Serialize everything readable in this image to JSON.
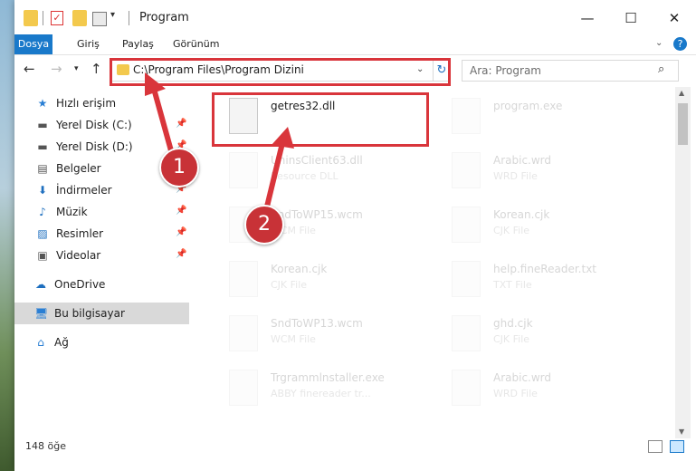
{
  "window": {
    "title": "Program"
  },
  "ribbon": {
    "tabs": [
      "Dosya",
      "Giriş",
      "Paylaş",
      "Görünüm"
    ]
  },
  "address": {
    "path": "C:\\Program Files\\Program Dizini"
  },
  "search": {
    "placeholder": "Ara: Program"
  },
  "sidebar": {
    "items": [
      {
        "label": "Hızlı erişim",
        "icon": "star-icon",
        "pinned": false
      },
      {
        "label": "Yerel Disk (C:)",
        "icon": "drive-icon",
        "pinned": true
      },
      {
        "label": "Yerel Disk (D:)",
        "icon": "drive-icon",
        "pinned": true
      },
      {
        "label": "Belgeler",
        "icon": "document-icon",
        "pinned": true
      },
      {
        "label": "İndirmeler",
        "icon": "download-icon",
        "pinned": true
      },
      {
        "label": "Müzik",
        "icon": "music-icon",
        "pinned": true
      },
      {
        "label": "Resimler",
        "icon": "picture-icon",
        "pinned": true
      },
      {
        "label": "Videolar",
        "icon": "video-icon",
        "pinned": true
      },
      {
        "label": "OneDrive",
        "icon": "cloud-icon",
        "pinned": false
      },
      {
        "label": "Bu bilgisayar",
        "icon": "computer-icon",
        "pinned": false
      },
      {
        "label": "Ağ",
        "icon": "network-icon",
        "pinned": false
      }
    ]
  },
  "files": [
    {
      "name": "getres32.dll",
      "type": "",
      "highlighted": true
    },
    {
      "name": "program.exe",
      "type": ""
    },
    {
      "name": "UninsClient63.dll",
      "type": "Resource DLL"
    },
    {
      "name": "Arabic.wrd",
      "type": "WRD File"
    },
    {
      "name": "SndToWP15.wcm",
      "type": "WCM File"
    },
    {
      "name": "Korean.cjk",
      "type": "CJK File"
    },
    {
      "name": "Korean.cjk",
      "type": "CJK File"
    },
    {
      "name": "help.fineReader.txt",
      "type": "TXT File"
    },
    {
      "name": "SndToWP13.wcm",
      "type": "WCM File"
    },
    {
      "name": "ghd.cjk",
      "type": "CJK File"
    },
    {
      "name": "Trgrammlnstaller.exe",
      "type": "ABBY finereader tr..."
    },
    {
      "name": "Arabic.wrd",
      "type": "WRD File"
    }
  ],
  "status": {
    "count": "148 öğe"
  },
  "annotations": {
    "step1": "1",
    "step2": "2",
    "color": "#d9353b"
  }
}
